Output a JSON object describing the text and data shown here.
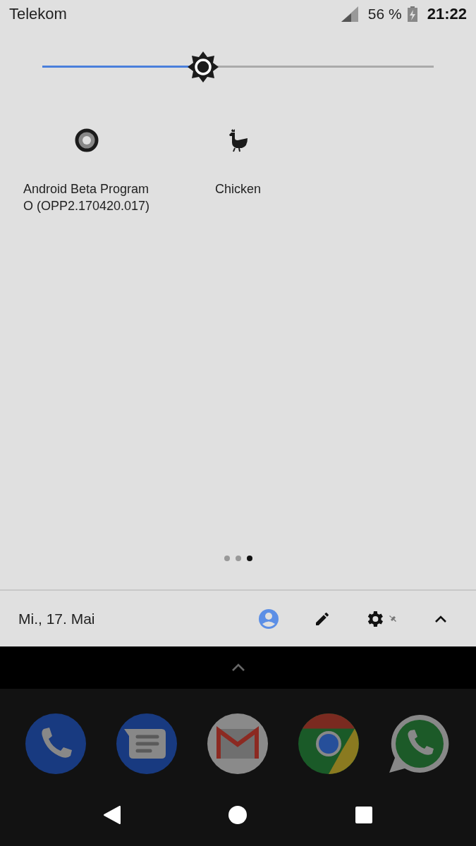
{
  "status_bar": {
    "carrier": "Telekom",
    "battery": "56 %",
    "time": "21:22"
  },
  "brightness": {
    "level": 0.41
  },
  "tiles": [
    {
      "label": "Android Beta Program\nO (OPP2.170420.017)",
      "kind": "beta"
    },
    {
      "label": "Chicken",
      "kind": "chicken"
    }
  ],
  "pages": [
    {
      "selected": false
    },
    {
      "selected": false
    },
    {
      "selected": true
    }
  ],
  "footer": {
    "date": "Mi., 17. Mai"
  },
  "dock": [
    {
      "kind": "phone"
    },
    {
      "kind": "messages"
    },
    {
      "kind": "mail"
    },
    {
      "kind": "browser"
    },
    {
      "kind": "chat"
    }
  ]
}
